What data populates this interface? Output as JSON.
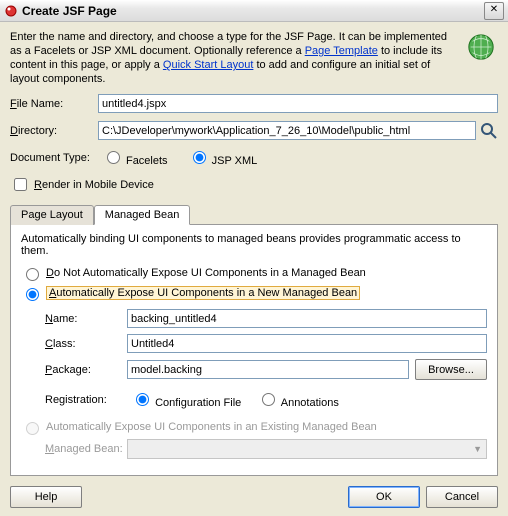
{
  "window": {
    "title": "Create JSF Page"
  },
  "intro": {
    "pre": "Enter the name and directory, and choose a type for the JSF Page. It can be implemented as a Facelets or JSP XML document. Optionally reference a ",
    "link1": "Page Template",
    "mid": " to include its content in this page, or apply a ",
    "link2": "Quick Start Layout",
    "post": " to add and configure an initial set of layout components."
  },
  "fields": {
    "file_name_label": "File Name:",
    "file_name_value": "untitled4.jspx",
    "directory_label": "Directory:",
    "directory_value": "C:\\JDeveloper\\mywork\\Application_7_26_10\\Model\\public_html",
    "doc_type_label": "Document Type:",
    "facelets_label": "Facelets",
    "jsp_xml_label": "JSP XML",
    "render_mobile_label": "Render in Mobile Device"
  },
  "tabs": {
    "page_layout": "Page Layout",
    "managed_bean": "Managed Bean"
  },
  "mb": {
    "desc": "Automatically binding UI components to managed beans provides programmatic access to them.",
    "opt_none": "Do Not Automatically Expose UI Components in a Managed Bean",
    "opt_new": "Automatically Expose UI Components in a New Managed Bean",
    "name_label": "Name:",
    "name_value": "backing_untitled4",
    "class_label": "Class:",
    "class_value": "Untitled4",
    "package_label": "Package:",
    "package_value": "model.backing",
    "browse_label": "Browse...",
    "reg_label": "Registration:",
    "reg_config": "Configuration File",
    "reg_anno": "Annotations",
    "opt_existing": "Automatically Expose UI Components in an Existing Managed Bean",
    "existing_label": "Managed Bean:"
  },
  "buttons": {
    "help": "Help",
    "ok": "OK",
    "cancel": "Cancel"
  }
}
